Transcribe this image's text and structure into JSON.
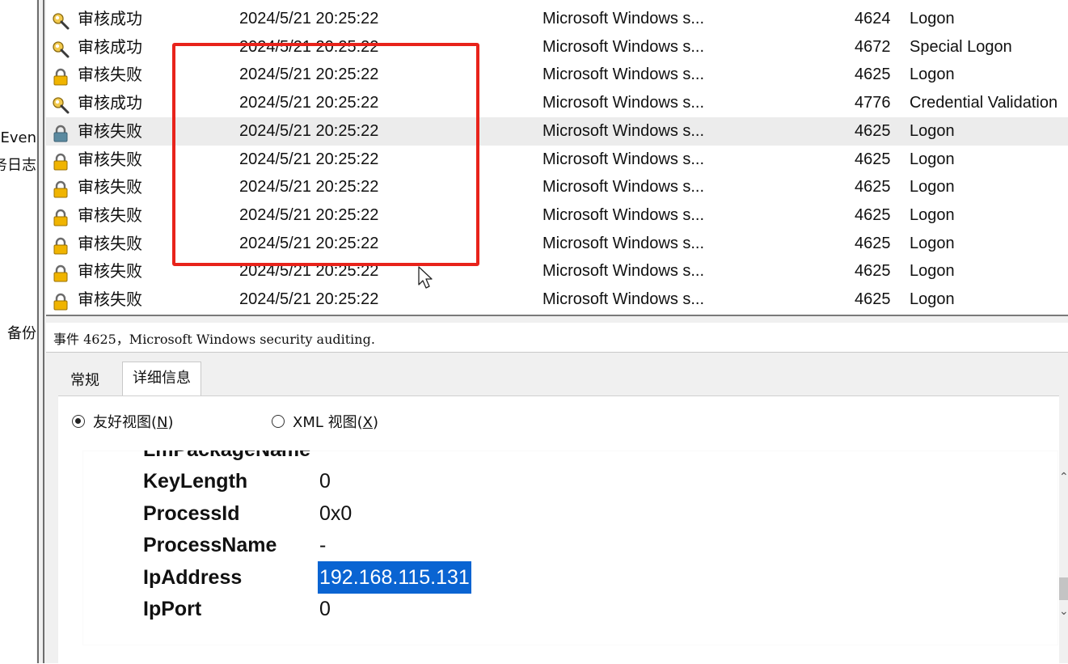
{
  "left_panel": {
    "items": [
      "Even",
      "务日志",
      "备份"
    ]
  },
  "event_list": {
    "rows": [
      {
        "keyword": "审核成功",
        "date": "2024/5/21 20:25:22",
        "source": "Microsoft Windows s...",
        "event_id": "4624",
        "task": "Logon",
        "icon": "key-icon"
      },
      {
        "keyword": "审核成功",
        "date": "2024/5/21 20:25:22",
        "source": "Microsoft Windows s...",
        "event_id": "4672",
        "task": "Special Logon",
        "icon": "key-icon"
      },
      {
        "keyword": "审核失败",
        "date": "2024/5/21 20:25:22",
        "source": "Microsoft Windows s...",
        "event_id": "4625",
        "task": "Logon",
        "icon": "lock-icon"
      },
      {
        "keyword": "审核成功",
        "date": "2024/5/21 20:25:22",
        "source": "Microsoft Windows s...",
        "event_id": "4776",
        "task": "Credential Validation",
        "icon": "key-icon"
      },
      {
        "keyword": "审核失败",
        "date": "2024/5/21 20:25:22",
        "source": "Microsoft Windows s...",
        "event_id": "4625",
        "task": "Logon",
        "icon": "lock-icon",
        "selected": true
      },
      {
        "keyword": "审核失败",
        "date": "2024/5/21 20:25:22",
        "source": "Microsoft Windows s...",
        "event_id": "4625",
        "task": "Logon",
        "icon": "lock-icon"
      },
      {
        "keyword": "审核失败",
        "date": "2024/5/21 20:25:22",
        "source": "Microsoft Windows s...",
        "event_id": "4625",
        "task": "Logon",
        "icon": "lock-icon"
      },
      {
        "keyword": "审核失败",
        "date": "2024/5/21 20:25:22",
        "source": "Microsoft Windows s...",
        "event_id": "4625",
        "task": "Logon",
        "icon": "lock-icon"
      },
      {
        "keyword": "审核失败",
        "date": "2024/5/21 20:25:22",
        "source": "Microsoft Windows s...",
        "event_id": "4625",
        "task": "Logon",
        "icon": "lock-icon"
      },
      {
        "keyword": "审核失败",
        "date": "2024/5/21 20:25:22",
        "source": "Microsoft Windows s...",
        "event_id": "4625",
        "task": "Logon",
        "icon": "lock-icon"
      },
      {
        "keyword": "审核失败",
        "date": "2024/5/21 20:25:22",
        "source": "Microsoft Windows s...",
        "event_id": "4625",
        "task": "Logon",
        "icon": "lock-icon"
      }
    ]
  },
  "detail": {
    "header": "事件 4625，Microsoft Windows security auditing.",
    "tabs": [
      "常规",
      "详细信息"
    ],
    "active_tab": "详细信息",
    "view_friendly": {
      "label": "友好视图(",
      "key": "N",
      "suffix": ")",
      "checked": true
    },
    "view_xml": {
      "label": "XML 视图(",
      "key": "X",
      "suffix": ")",
      "checked": false
    },
    "partial_top": {
      "key": "LmPackageName",
      "value": "-"
    },
    "fields": [
      {
        "key": "KeyLength",
        "value": "0"
      },
      {
        "key": "ProcessId",
        "value": "0x0"
      },
      {
        "key": "ProcessName",
        "value": "-"
      },
      {
        "key": "IpAddress",
        "value": "192.168.115.131",
        "highlighted": true
      },
      {
        "key": "IpPort",
        "value": "0"
      }
    ]
  },
  "colors": {
    "annotation_box": "#e8231b",
    "selection_highlight": "#0a64d2",
    "selected_row": "#ececec"
  }
}
